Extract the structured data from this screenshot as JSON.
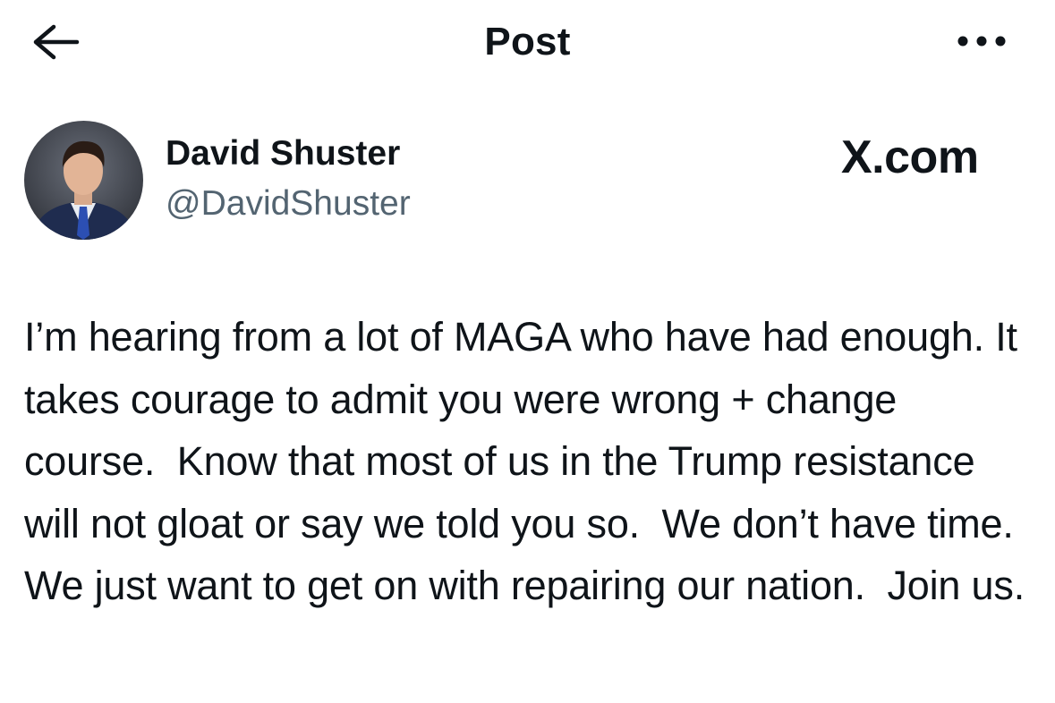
{
  "header": {
    "title": "Post",
    "back_icon": "arrow-left-icon",
    "more_icon": "more-horizontal-icon"
  },
  "author": {
    "name": "David Shuster",
    "handle": "@DavidShuster",
    "avatar": "profile-photo"
  },
  "brand": {
    "label": "X.com"
  },
  "post": {
    "text": "I’m hearing from a lot of MAGA who have had enough. It takes courage to admit you were wrong + change course.  Know that most of us in the Trump resistance will not gloat or say we told you so.  We don’t have time. We just want to get on with repairing our nation.  Join us."
  },
  "colors": {
    "text_primary": "#0f1419",
    "text_secondary": "#536471",
    "background": "#ffffff"
  }
}
